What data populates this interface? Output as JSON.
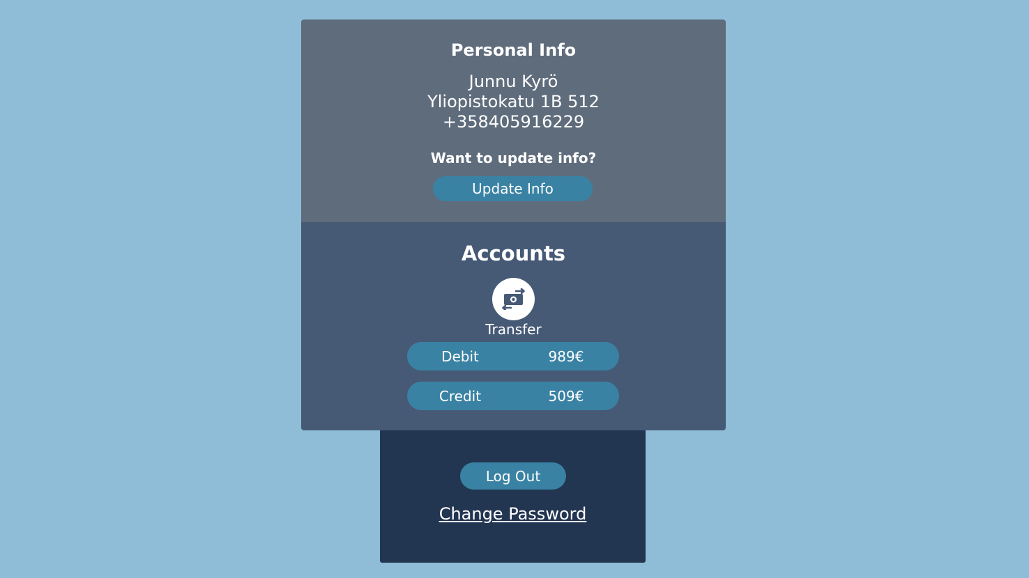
{
  "personal": {
    "title": "Personal Info",
    "name": "Junnu Kyrö",
    "address": "Yliopistokatu 1B 512",
    "phone": "+358405916229",
    "update_prompt": "Want to update info?",
    "update_button": "Update Info"
  },
  "accounts": {
    "title": "Accounts",
    "transfer_icon": "money-transfer-icon",
    "transfer_label": "Transfer",
    "items": [
      {
        "name": "Debit",
        "balance": "989€"
      },
      {
        "name": "Credit",
        "balance": "509€"
      }
    ]
  },
  "footer": {
    "logout_button": "Log Out",
    "change_password_link": "Change Password"
  },
  "colors": {
    "background": "#8fbcd7",
    "personal_panel": "#5f6c7c",
    "accounts_panel": "#465a76",
    "footer_panel": "#223551",
    "accent": "#3a82a3"
  }
}
